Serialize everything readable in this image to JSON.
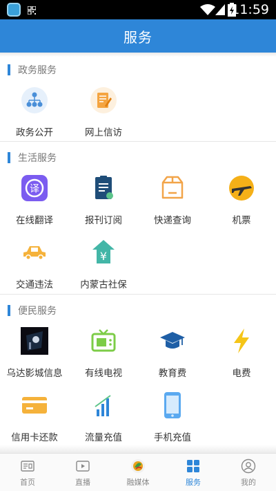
{
  "status_bar": {
    "time": "11:59"
  },
  "header": {
    "title": "服务"
  },
  "sections": [
    {
      "title": "政务服务",
      "items": [
        {
          "label": "政务公开",
          "icon": "org-chart-icon"
        },
        {
          "label": "网上信访",
          "icon": "petition-note-icon"
        }
      ]
    },
    {
      "title": "生活服务",
      "items": [
        {
          "label": "在线翻译",
          "icon": "translate-icon"
        },
        {
          "label": "报刊订阅",
          "icon": "newspaper-icon"
        },
        {
          "label": "快递查询",
          "icon": "parcel-box-icon"
        },
        {
          "label": "机票",
          "icon": "airplane-icon"
        },
        {
          "label": "交通违法",
          "icon": "car-icon"
        },
        {
          "label": "内蒙古社保",
          "icon": "social-security-icon"
        }
      ]
    },
    {
      "title": "便民服务",
      "items": [
        {
          "label": "乌达影城信息",
          "icon": "cinema-photo-icon"
        },
        {
          "label": "有线电视",
          "icon": "tv-icon"
        },
        {
          "label": "教育费",
          "icon": "graduation-cap-icon"
        },
        {
          "label": "电费",
          "icon": "lightning-icon"
        },
        {
          "label": "信用卡还款",
          "icon": "credit-card-icon"
        },
        {
          "label": "流量充值",
          "icon": "signal-bars-icon"
        },
        {
          "label": "手机充值",
          "icon": "mobile-phone-icon"
        }
      ]
    }
  ],
  "tabs": [
    {
      "label": "首页",
      "icon": "news-icon",
      "active": false
    },
    {
      "label": "直播",
      "icon": "play-icon",
      "active": false
    },
    {
      "label": "融媒体",
      "icon": "media-logo-icon",
      "active": false
    },
    {
      "label": "服务",
      "icon": "grid-icon",
      "active": true
    },
    {
      "label": "我的",
      "icon": "profile-icon",
      "active": false
    }
  ],
  "colors": {
    "accent": "#2e86d8",
    "status_bar": "#000000"
  }
}
